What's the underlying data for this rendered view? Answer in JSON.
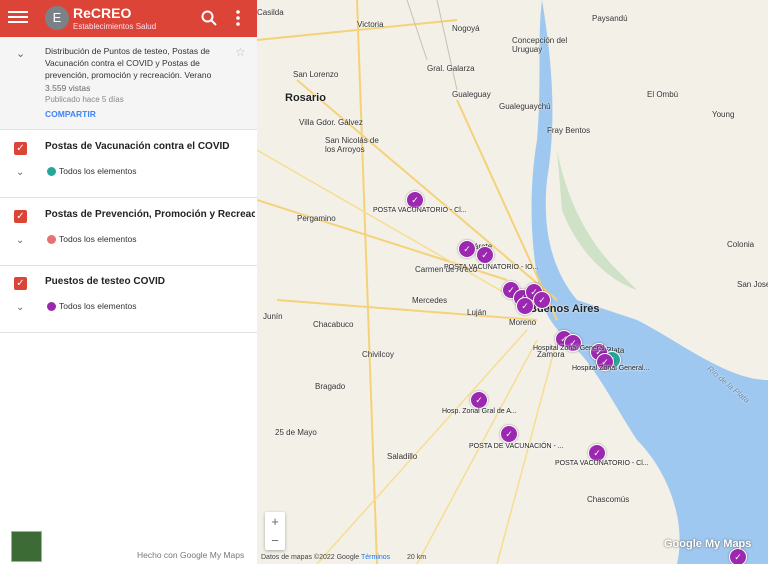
{
  "header": {
    "avatar_letter": "E",
    "title": "ReCREO",
    "subtitle": "Establecimientos Salud"
  },
  "description": {
    "text": "Distribución de Puntos de testeo, Postas de Vacunación contra el COVID y Postas de prevención, promoción y recreación. Verano",
    "views": "3.559 vistas",
    "published": "Publicado hace 5 días",
    "share_label": "COMPARTIR"
  },
  "layers": [
    {
      "title": "Postas de Vacunación contra el COVID",
      "items_label": "Todos los elementos",
      "icon_color": "#26a69a"
    },
    {
      "title": "Postas de Prevención, Promoción y Recreación",
      "items_label": "Todos los elementos",
      "icon_color": "#e57373"
    },
    {
      "title": "Puestos de testeo COVID",
      "items_label": "Todos los elementos",
      "icon_color": "#9c27b0"
    }
  ],
  "made_with": "Hecho con Google My Maps",
  "map": {
    "zoom_in": "+",
    "zoom_out": "−",
    "footer_data": "Datos de mapas ©2022 Google",
    "footer_terms": "Términos",
    "scale": "20 km",
    "logo": "Google My Maps",
    "cities": {
      "rosario": "Rosario",
      "paysandu": "Paysandú",
      "concepcion": "Concepción del Uruguay",
      "gualeguaychu": "Gualeguaychú",
      "fray_bentos": "Fray Bentos",
      "san_nicolas": "San Nicolás de los Arroyos",
      "pergamino": "Pergamino",
      "buenos_aires": "Buenos Aires",
      "lujan": "Luján",
      "moreno": "Moreno",
      "zarate": "Zárate",
      "chivilcoy": "Chivilcoy",
      "la_plata": "La Plata",
      "zamora": "Zamora",
      "san_lorenzo": "San Lorenzo",
      "villa_gdor": "Villa Gdor. Gálvez",
      "casilda": "Casilda",
      "victoria": "Victoria",
      "gral_galarza": "Gral. Galarza",
      "nogoya": "Nogoyá",
      "gualeguay": "Gualeguay",
      "san_jose": "San José",
      "colonia": "Colonia",
      "junin": "Junín",
      "chacabuco": "Chacabuco",
      "carmen": "Carmen de Areco",
      "mercedes": "Mercedes",
      "bragado": "Bragado",
      "25_mayo": "25 de Mayo",
      "saladillo": "Saladillo",
      "chascomus": "Chascomús",
      "rio_plata": "Río de la Plata",
      "el_ombu": "El Ombú",
      "young": "Young"
    },
    "labels": [
      "POSTA VACUNATORIO - Cl...",
      "POSTA VACUNATORIO - IO...",
      "Hospital Zonal General...",
      "Hosp. Zonal Gral de A...",
      "POSTA DE VACUNACIÓN - ...",
      "POSTA VACUNATORIO - Cl...",
      "Hospital Zonal General..."
    ]
  }
}
